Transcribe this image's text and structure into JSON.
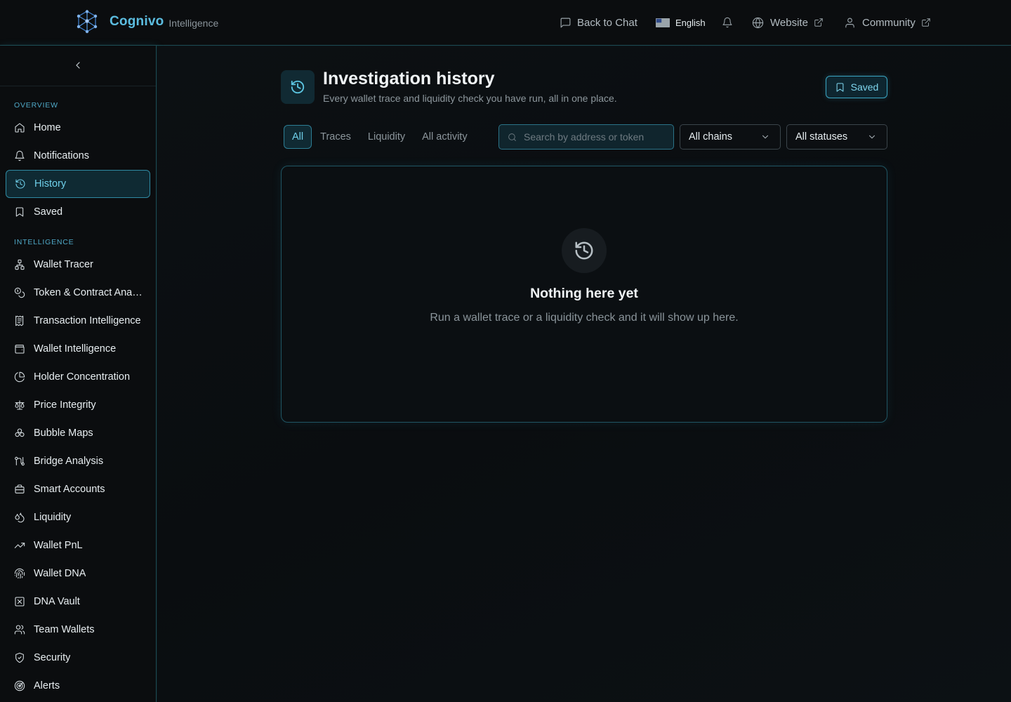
{
  "brand": {
    "name": "Cognivo",
    "sub": "Intelligence"
  },
  "topnav": {
    "back_to_chat": "Back to Chat",
    "language": "English",
    "website": "Website",
    "community": "Community"
  },
  "sidebar": {
    "overview_label": "OVERVIEW",
    "intelligence_label": "INTELLIGENCE",
    "overview_items": [
      {
        "label": "Home",
        "icon": "home-icon"
      },
      {
        "label": "Notifications",
        "icon": "bell-icon"
      },
      {
        "label": "History",
        "icon": "history-icon",
        "active": true
      },
      {
        "label": "Saved",
        "icon": "bookmark-icon"
      }
    ],
    "intelligence_items": [
      {
        "label": "Wallet Tracer",
        "icon": "network-icon"
      },
      {
        "label": "Token & Contract Analysis",
        "icon": "coins-icon"
      },
      {
        "label": "Transaction Intelligence",
        "icon": "receipt-icon"
      },
      {
        "label": "Wallet Intelligence",
        "icon": "wallet-icon"
      },
      {
        "label": "Holder Concentration",
        "icon": "pie-chart-icon"
      },
      {
        "label": "Price Integrity",
        "icon": "scale-icon"
      },
      {
        "label": "Bubble Maps",
        "icon": "bubbles-icon"
      },
      {
        "label": "Bridge Analysis",
        "icon": "bridge-icon"
      },
      {
        "label": "Smart Accounts",
        "icon": "briefcase-icon"
      },
      {
        "label": "Liquidity",
        "icon": "droplets-icon"
      },
      {
        "label": "Wallet PnL",
        "icon": "trending-up-icon"
      },
      {
        "label": "Wallet DNA",
        "icon": "fingerprint-icon"
      },
      {
        "label": "DNA Vault",
        "icon": "vault-icon"
      },
      {
        "label": "Team Wallets",
        "icon": "users-icon"
      },
      {
        "label": "Security",
        "icon": "shield-icon"
      },
      {
        "label": "Alerts",
        "icon": "radar-icon"
      }
    ]
  },
  "page": {
    "title": "Investigation history",
    "subtitle": "Every wallet trace and liquidity check you have run, all in one place.",
    "saved_button": "Saved"
  },
  "filters": {
    "tabs": [
      "All",
      "Traces",
      "Liquidity",
      "All activity"
    ],
    "active_tab": "All",
    "search_placeholder": "Search by address or token",
    "chains_value": "All chains",
    "status_value": "All statuses"
  },
  "empty_state": {
    "title": "Nothing here yet",
    "text": "Run a wallet trace or a liquidity check and it will show up here."
  },
  "colors": {
    "accent": "#5cc6e2",
    "brand": "#5cbde0",
    "background": "#0a0c0e"
  }
}
